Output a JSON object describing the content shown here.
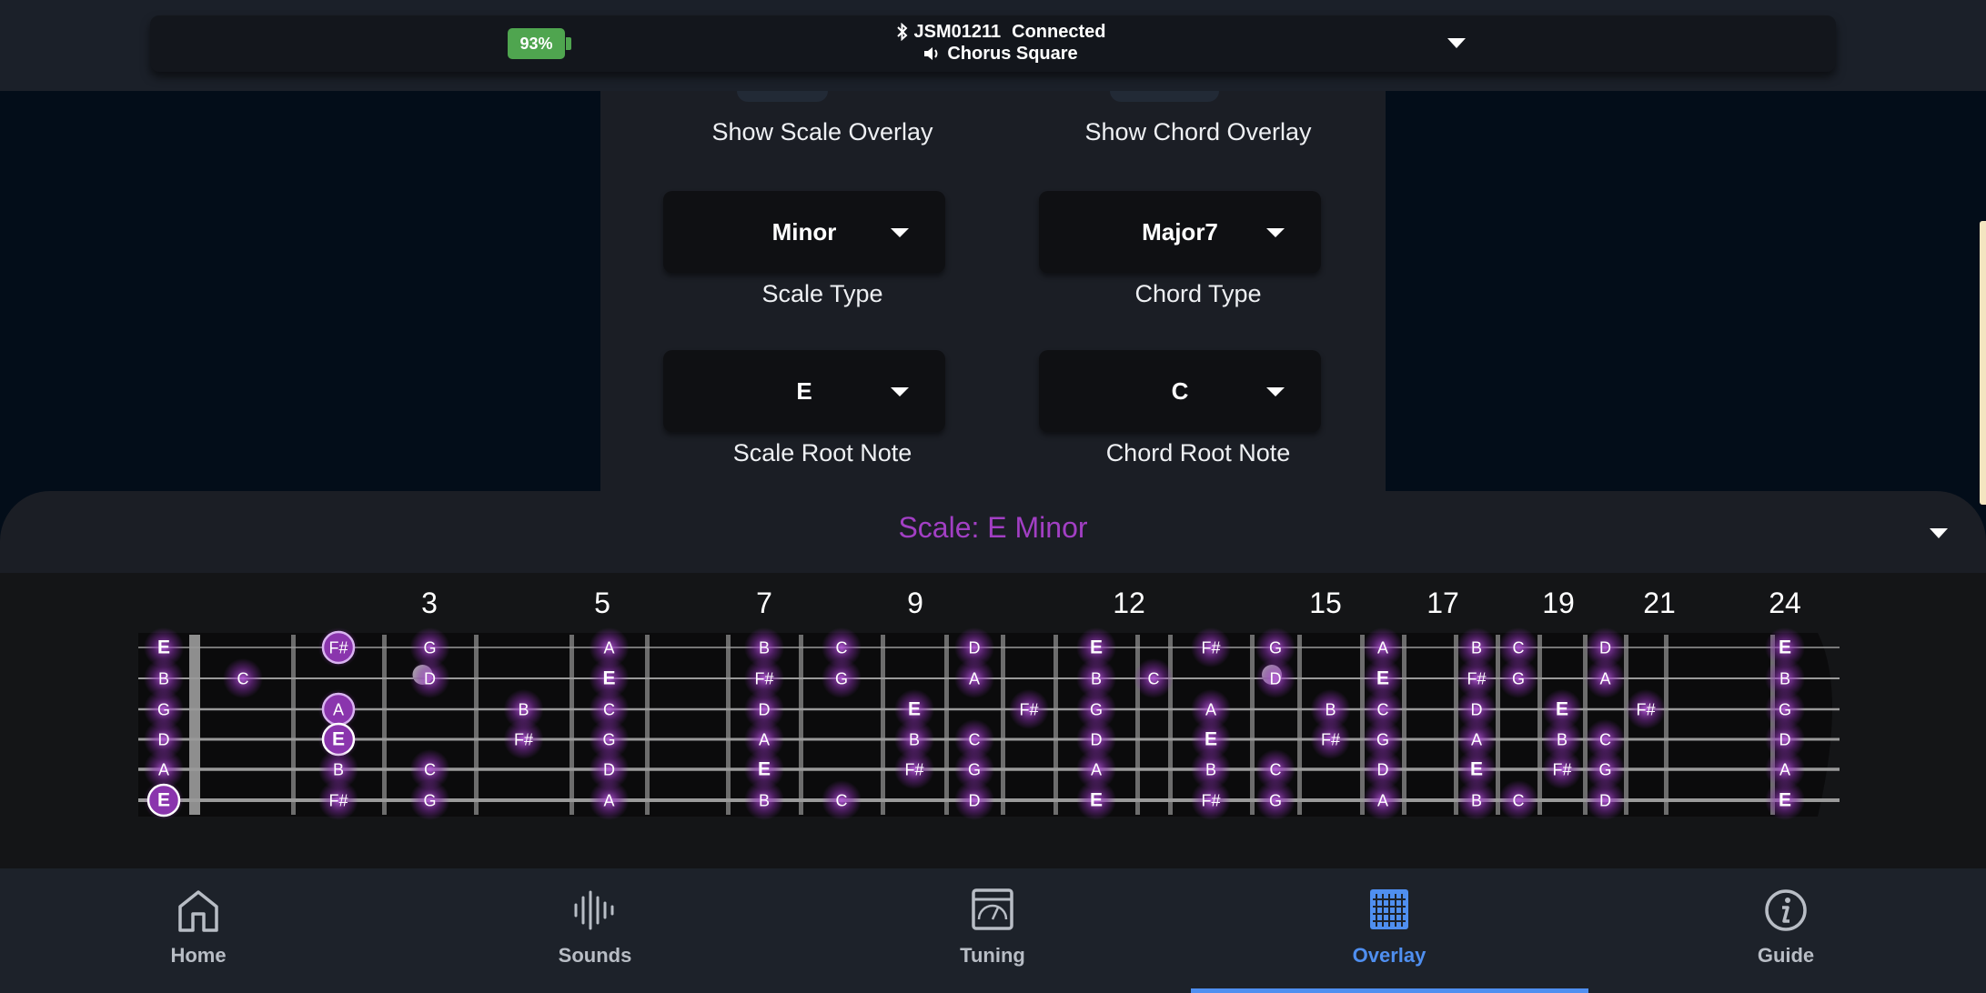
{
  "status_bar": {
    "battery": "93%",
    "device": "JSM01211",
    "connection": "Connected",
    "sound": "Chorus Square",
    "colors": {
      "battery": "#4fa54f"
    }
  },
  "overlay_settings": {
    "show_scale_label": "Show Scale Overlay",
    "show_chord_label": "Show Chord Overlay",
    "scale_type": {
      "value": "Minor",
      "label": "Scale Type"
    },
    "chord_type": {
      "value": "Major7",
      "label": "Chord Type"
    },
    "scale_root": {
      "value": "E",
      "label": "Scale Root Note"
    },
    "chord_root": {
      "value": "C",
      "label": "Chord Root Note"
    }
  },
  "fretboard": {
    "title": "Scale: E Minor",
    "title_color": "#a23fc4",
    "fret_numbers": [
      "3",
      "5",
      "7",
      "9",
      "12",
      "15",
      "17",
      "19",
      "21",
      "24"
    ],
    "strings": [
      {
        "name": "high-e",
        "notes": [
          [
            "E",
            0
          ],
          [
            "F#",
            2
          ],
          [
            "G",
            3
          ],
          [
            "A",
            5
          ],
          [
            "B",
            7
          ],
          [
            "C",
            8
          ],
          [
            "D",
            10
          ],
          [
            "E",
            12
          ],
          [
            "F#",
            14
          ],
          [
            "G",
            15
          ],
          [
            "A",
            17
          ],
          [
            "B",
            19
          ],
          [
            "C",
            20
          ],
          [
            "D",
            22
          ],
          [
            "E",
            24
          ]
        ]
      },
      {
        "name": "b",
        "notes": [
          [
            "B",
            0
          ],
          [
            "C",
            1
          ],
          [
            "D",
            3
          ],
          [
            "E",
            5
          ],
          [
            "F#",
            7
          ],
          [
            "G",
            8
          ],
          [
            "A",
            10
          ],
          [
            "B",
            12
          ],
          [
            "C",
            13
          ],
          [
            "D",
            15
          ],
          [
            "E",
            17
          ],
          [
            "F#",
            19
          ],
          [
            "G",
            20
          ],
          [
            "A",
            22
          ],
          [
            "B",
            24
          ]
        ]
      },
      {
        "name": "g",
        "notes": [
          [
            "G",
            0
          ],
          [
            "A",
            2
          ],
          [
            "B",
            4
          ],
          [
            "C",
            5
          ],
          [
            "D",
            7
          ],
          [
            "E",
            9
          ],
          [
            "F#",
            11
          ],
          [
            "G",
            12
          ],
          [
            "A",
            14
          ],
          [
            "B",
            16
          ],
          [
            "C",
            17
          ],
          [
            "D",
            19
          ],
          [
            "E",
            21
          ],
          [
            "F#",
            23
          ],
          [
            "G",
            24
          ]
        ]
      },
      {
        "name": "d",
        "notes": [
          [
            "D",
            0
          ],
          [
            "E",
            2
          ],
          [
            "F#",
            4
          ],
          [
            "G",
            5
          ],
          [
            "A",
            7
          ],
          [
            "B",
            9
          ],
          [
            "C",
            10
          ],
          [
            "D",
            12
          ],
          [
            "E",
            14
          ],
          [
            "F#",
            16
          ],
          [
            "G",
            17
          ],
          [
            "A",
            19
          ],
          [
            "B",
            21
          ],
          [
            "C",
            22
          ],
          [
            "D",
            24
          ]
        ]
      },
      {
        "name": "a",
        "notes": [
          [
            "A",
            0
          ],
          [
            "B",
            2
          ],
          [
            "C",
            3
          ],
          [
            "D",
            5
          ],
          [
            "E",
            7
          ],
          [
            "F#",
            9
          ],
          [
            "G",
            10
          ],
          [
            "A",
            12
          ],
          [
            "B",
            14
          ],
          [
            "C",
            15
          ],
          [
            "D",
            17
          ],
          [
            "E",
            19
          ],
          [
            "F#",
            21
          ],
          [
            "G",
            22
          ],
          [
            "A",
            24
          ]
        ]
      },
      {
        "name": "low-e",
        "notes": [
          [
            "E",
            0
          ],
          [
            "F#",
            2
          ],
          [
            "G",
            3
          ],
          [
            "A",
            5
          ],
          [
            "B",
            7
          ],
          [
            "C",
            8
          ],
          [
            "D",
            10
          ],
          [
            "E",
            12
          ],
          [
            "F#",
            14
          ],
          [
            "G",
            15
          ],
          [
            "A",
            17
          ],
          [
            "B",
            19
          ],
          [
            "C",
            20
          ],
          [
            "D",
            22
          ],
          [
            "E",
            24
          ]
        ]
      }
    ],
    "highlighted_positions": [
      [
        "high-e",
        2
      ],
      [
        "g",
        2
      ],
      [
        "d",
        2
      ],
      [
        "low-e",
        0
      ]
    ]
  },
  "nav": {
    "tabs": [
      {
        "label": "Home",
        "icon": "home-icon"
      },
      {
        "label": "Sounds",
        "icon": "waveform-icon"
      },
      {
        "label": "Tuning",
        "icon": "tuner-icon"
      },
      {
        "label": "Overlay",
        "icon": "fretboard-grid-icon",
        "active": true
      },
      {
        "label": "Guide",
        "icon": "info-icon"
      }
    ],
    "active_color": "#4f8ff0"
  }
}
